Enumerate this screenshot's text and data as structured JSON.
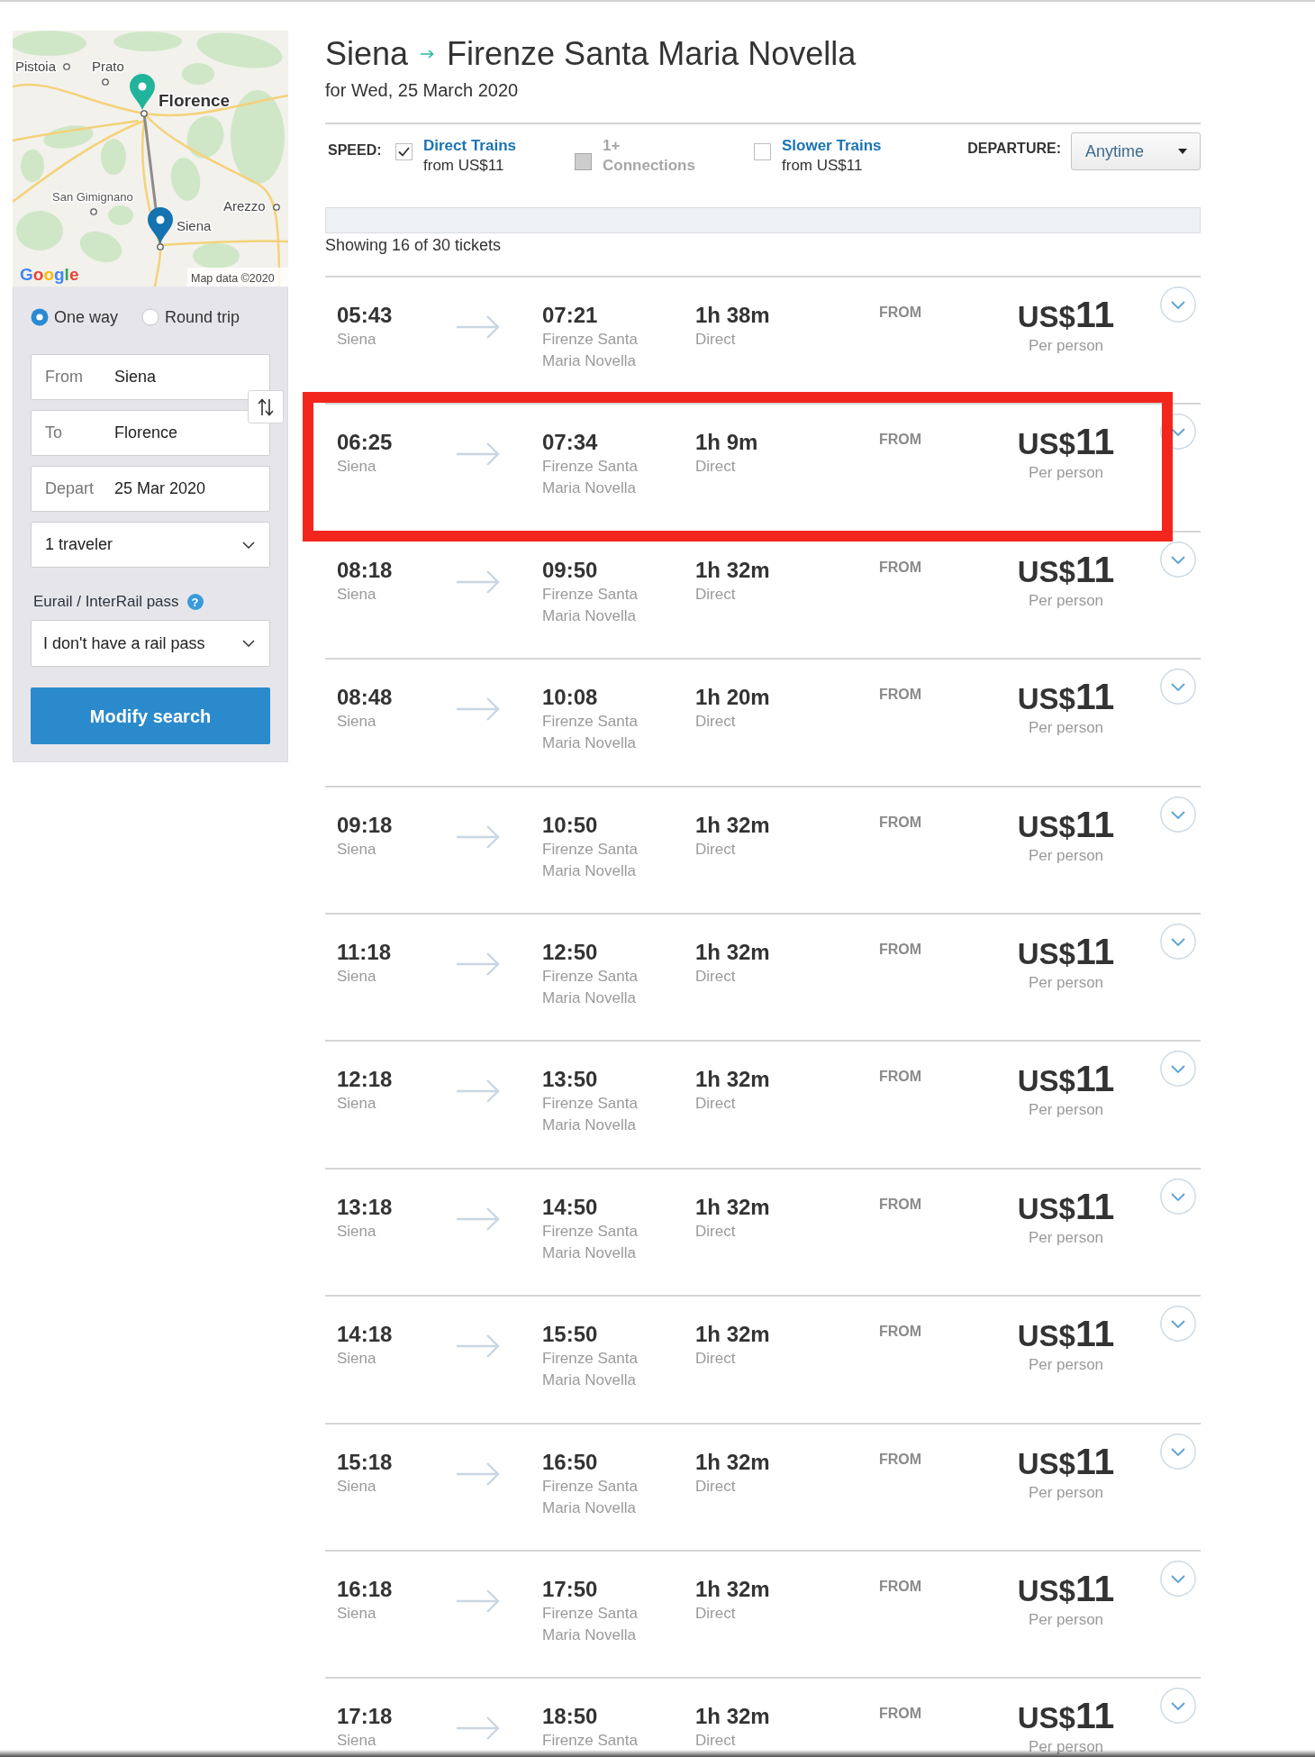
{
  "map": {
    "labels": [
      {
        "text": "Pistoia",
        "kind": "town"
      },
      {
        "text": "Prato",
        "kind": "town"
      },
      {
        "text": "Florence",
        "kind": "city"
      },
      {
        "text": "San Gimignano",
        "kind": "village"
      },
      {
        "text": "Arezzo",
        "kind": "town"
      },
      {
        "text": "Siena",
        "kind": "town"
      }
    ],
    "logo": "Google",
    "attribution": "Map data ©2020"
  },
  "search_form": {
    "trip_types": [
      {
        "label": "One way",
        "selected": true
      },
      {
        "label": "Round trip",
        "selected": false
      }
    ],
    "fields": [
      {
        "label": "From",
        "value": "Siena"
      },
      {
        "label": "To",
        "value": "Florence"
      },
      {
        "label": "Depart",
        "value": "25 Mar 2020"
      }
    ],
    "travelers": "1 traveler",
    "pass_label": "Eurail / InterRail pass",
    "help": "?",
    "rail_pass": "I don't have a rail pass",
    "submit": "Modify search"
  },
  "header": {
    "origin": "Siena",
    "destination": "Firenze Santa Maria Novella",
    "date": "for Wed, 25 March 2020"
  },
  "filters": {
    "speed_label": "SPEED:",
    "options": [
      {
        "title": "Direct Trains",
        "subtitle": "from US$11",
        "checked": true,
        "disabled": false
      },
      {
        "title": "1+ Connections",
        "checked": false,
        "disabled": true
      },
      {
        "title": "Slower Trains",
        "subtitle": "from US$11",
        "checked": false,
        "disabled": false
      }
    ],
    "departure_label": "DEPARTURE:",
    "departure": "Anytime"
  },
  "results_count": "Showing 16 of 30 tickets",
  "trips": [
    {
      "depart": "05:43",
      "origin": "Siena",
      "arrive": "07:21",
      "destination": "Firenze Santa Maria Novella",
      "duration": "1h 38m",
      "service": "Direct",
      "from_label": "FROM",
      "currency": "US$",
      "amount": "11",
      "unit": "Per person",
      "highlighted": false
    },
    {
      "depart": "06:25",
      "origin": "Siena",
      "arrive": "07:34",
      "destination": "Firenze Santa Maria Novella",
      "duration": "1h 9m",
      "service": "Direct",
      "from_label": "FROM",
      "currency": "US$",
      "amount": "11",
      "unit": "Per person",
      "highlighted": true
    },
    {
      "depart": "08:18",
      "origin": "Siena",
      "arrive": "09:50",
      "destination": "Firenze Santa Maria Novella",
      "duration": "1h 32m",
      "service": "Direct",
      "from_label": "FROM",
      "currency": "US$",
      "amount": "11",
      "unit": "Per person",
      "highlighted": false
    },
    {
      "depart": "08:48",
      "origin": "Siena",
      "arrive": "10:08",
      "destination": "Firenze Santa Maria Novella",
      "duration": "1h 20m",
      "service": "Direct",
      "from_label": "FROM",
      "currency": "US$",
      "amount": "11",
      "unit": "Per person",
      "highlighted": false
    },
    {
      "depart": "09:18",
      "origin": "Siena",
      "arrive": "10:50",
      "destination": "Firenze Santa Maria Novella",
      "duration": "1h 32m",
      "service": "Direct",
      "from_label": "FROM",
      "currency": "US$",
      "amount": "11",
      "unit": "Per person",
      "highlighted": false
    },
    {
      "depart": "11:18",
      "origin": "Siena",
      "arrive": "12:50",
      "destination": "Firenze Santa Maria Novella",
      "duration": "1h 32m",
      "service": "Direct",
      "from_label": "FROM",
      "currency": "US$",
      "amount": "11",
      "unit": "Per person",
      "highlighted": false
    },
    {
      "depart": "12:18",
      "origin": "Siena",
      "arrive": "13:50",
      "destination": "Firenze Santa Maria Novella",
      "duration": "1h 32m",
      "service": "Direct",
      "from_label": "FROM",
      "currency": "US$",
      "amount": "11",
      "unit": "Per person",
      "highlighted": false
    },
    {
      "depart": "13:18",
      "origin": "Siena",
      "arrive": "14:50",
      "destination": "Firenze Santa Maria Novella",
      "duration": "1h 32m",
      "service": "Direct",
      "from_label": "FROM",
      "currency": "US$",
      "amount": "11",
      "unit": "Per person",
      "highlighted": false
    },
    {
      "depart": "14:18",
      "origin": "Siena",
      "arrive": "15:50",
      "destination": "Firenze Santa Maria Novella",
      "duration": "1h 32m",
      "service": "Direct",
      "from_label": "FROM",
      "currency": "US$",
      "amount": "11",
      "unit": "Per person",
      "highlighted": false
    },
    {
      "depart": "15:18",
      "origin": "Siena",
      "arrive": "16:50",
      "destination": "Firenze Santa Maria Novella",
      "duration": "1h 32m",
      "service": "Direct",
      "from_label": "FROM",
      "currency": "US$",
      "amount": "11",
      "unit": "Per person",
      "highlighted": false
    },
    {
      "depart": "16:18",
      "origin": "Siena",
      "arrive": "17:50",
      "destination": "Firenze Santa Maria Novella",
      "duration": "1h 32m",
      "service": "Direct",
      "from_label": "FROM",
      "currency": "US$",
      "amount": "11",
      "unit": "Per person",
      "highlighted": false
    },
    {
      "depart": "17:18",
      "origin": "Siena",
      "arrive": "18:50",
      "destination": "Firenze Santa",
      "duration": "1h 32m",
      "service": "Direct",
      "from_label": "FROM",
      "currency": "US$",
      "amount": "11",
      "unit": "Per person",
      "highlighted": false
    }
  ]
}
